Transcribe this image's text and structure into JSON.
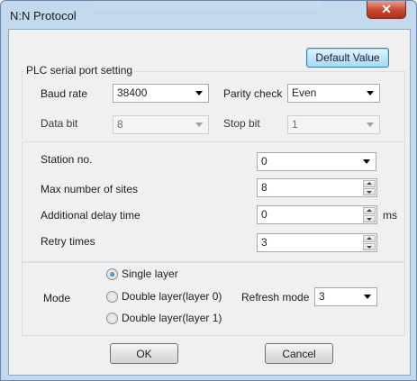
{
  "window": {
    "title": "N:N Protocol",
    "close_glyph": "✕"
  },
  "buttons": {
    "default_value": "Default Value",
    "ok": "OK",
    "cancel": "Cancel"
  },
  "plc_group": {
    "label": "PLC serial port setting",
    "baud_rate": {
      "label": "Baud rate",
      "value": "38400"
    },
    "parity_check": {
      "label": "Parity check",
      "value": "Even"
    },
    "data_bit": {
      "label": "Data bit",
      "value": "8"
    },
    "stop_bit": {
      "label": "Stop bit",
      "value": "1"
    }
  },
  "station_group": {
    "station_no": {
      "label": "Station no.",
      "value": "0"
    },
    "max_sites": {
      "label": "Max number of sites",
      "value": "8"
    },
    "delay": {
      "label": "Additional delay time",
      "value": "0",
      "unit": "ms"
    },
    "retry": {
      "label": "Retry times",
      "value": "3"
    }
  },
  "mode_group": {
    "label": "Mode",
    "options": [
      {
        "label": "Single layer",
        "checked": true
      },
      {
        "label": "Double layer(layer 0)",
        "checked": false
      },
      {
        "label": "Double layer(layer 1)",
        "checked": false
      }
    ],
    "refresh_mode": {
      "label": "Refresh mode",
      "value": "3"
    }
  }
}
